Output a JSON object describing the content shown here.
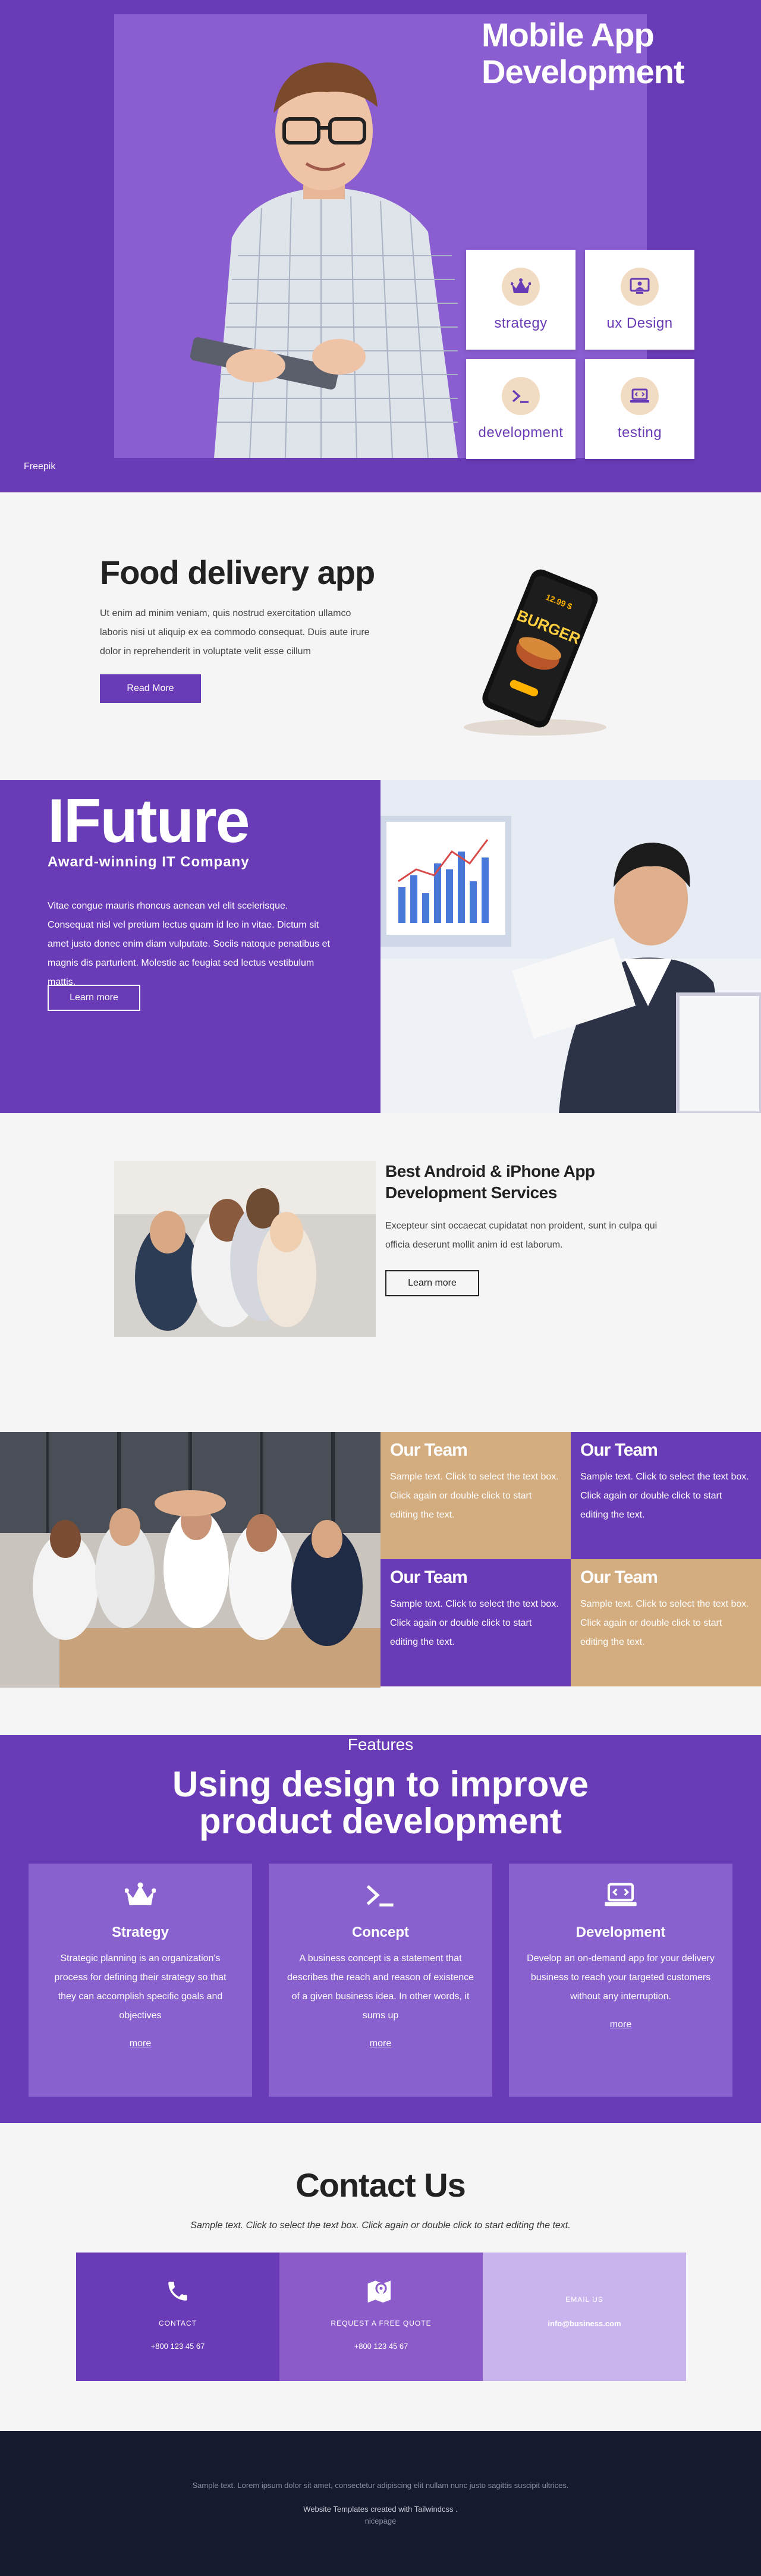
{
  "hero": {
    "title_line1": "Mobile App",
    "title_line2": "Development",
    "tiles": [
      {
        "label": "strategy",
        "icon": "crown-icon"
      },
      {
        "label": "ux Design",
        "icon": "monitor-person-icon"
      },
      {
        "label": "development",
        "icon": "terminal-icon"
      },
      {
        "label": "testing",
        "icon": "laptop-code-icon"
      }
    ],
    "credit": "Freepik",
    "colors": {
      "bg": "#6a3bb7",
      "panel": "#8a5dd0",
      "icon_bg": "#f1dcc3"
    }
  },
  "food": {
    "title": "Food delivery app",
    "text": "Ut enim ad minim veniam, quis nostrud exercitation ullamco laboris nisi ut aliquip ex ea commodo consequat. Duis aute irure dolor in reprehenderit in voluptate velit esse cillum",
    "button": "Read More",
    "phone_price": "12.99 $",
    "phone_word": "BURGER"
  },
  "ifuture": {
    "title": "IFuture",
    "subtitle": "Award-winning IT Company",
    "text": "Vitae congue mauris rhoncus aenean vel elit scelerisque. Consequat nisl vel pretium lectus quam id leo in vitae. Dictum sit amet justo donec enim diam vulputate. Sociis natoque penatibus et magnis dis parturient. Molestie ac feugiat sed lectus vestibulum mattis.",
    "button": "Learn more"
  },
  "best": {
    "title": "Best Android & iPhone App Development Services",
    "text": "Excepteur sint occaecat cupidatat non proident, sunt in culpa qui officia deserunt mollit anim id est laborum.",
    "button": "Learn more"
  },
  "team": {
    "cells": [
      {
        "title": "Our Team",
        "text": "Sample text. Click to select the text box. Click again or double click to start editing the text."
      },
      {
        "title": "Our Team",
        "text": "Sample text. Click to select the text box. Click again or double click to start editing the text."
      },
      {
        "title": "Our Team",
        "text": "Sample text. Click to select the text box. Click again or double click to start editing the text."
      },
      {
        "title": "Our Team",
        "text": "Sample text. Click to select the text box. Click again or double click to start editing the text."
      }
    ],
    "colors": {
      "tan": "#d3ad7f",
      "purple": "#6a3bb7"
    }
  },
  "features": {
    "overline": "Features",
    "title_line1": "Using design to improve",
    "title_line2": "product development",
    "cards": [
      {
        "title": "Strategy",
        "text": "Strategic planning is an organization's process for defining their strategy so that they can accomplish specific goals and objectives",
        "link": "more",
        "icon": "crown-icon"
      },
      {
        "title": "Concept",
        "text": "A business concept is a statement that describes the reach and reason of existence of a given business idea. In other words, it sums up",
        "link": "more",
        "icon": "terminal-icon"
      },
      {
        "title": "Development",
        "text": "Develop an on-demand app for your delivery business to reach your targeted customers without any interruption.",
        "link": "more",
        "icon": "laptop-code-icon"
      }
    ]
  },
  "contact": {
    "title": "Contact Us",
    "subtitle": "Sample text. Click to select the text box. Click again or double click to start editing the text.",
    "boxes": [
      {
        "label": "CONTACT",
        "value": "+800 123 45 67",
        "icon": "phone-icon",
        "color": "#6a3bb7"
      },
      {
        "label": "REQUEST A FREE QUOTE",
        "value": "+800 123 45 67",
        "icon": "map-pin-icon",
        "color": "#8b5cc9"
      },
      {
        "label": "EMAIL US",
        "value": "info@business.com",
        "icon": "",
        "color": "#c9b4ee"
      }
    ]
  },
  "footer": {
    "text": "Sample text. Lorem ipsum dolor sit amet, consectetur adipiscing elit nullam nunc justo sagittis suscipit ultrices.",
    "credit": "Website Templates created with Tailwindcss .",
    "link": "nicepage"
  }
}
